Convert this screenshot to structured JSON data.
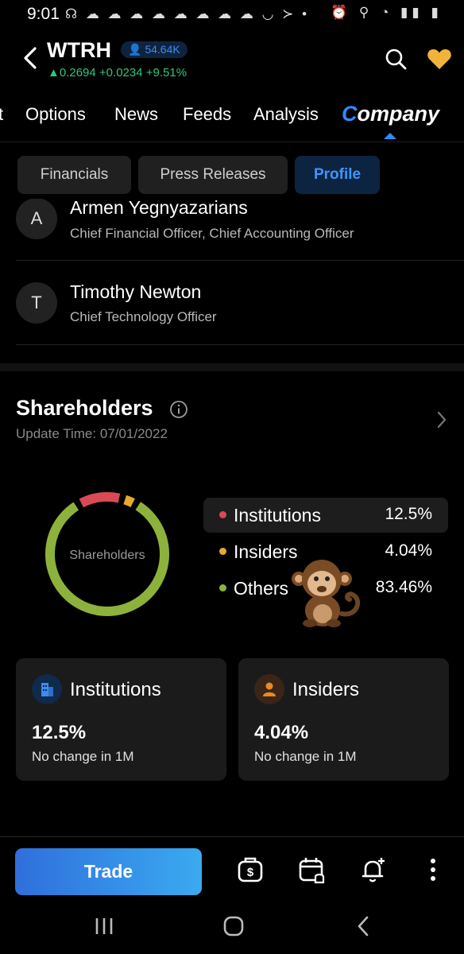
{
  "status_bar": {
    "time": "9:01",
    "left_icons": "☊ ☁ ☁ ☁ ☁ ☁ ☁ ☁ ☁ ◡ ≻ •",
    "right_icons": "⏰ ⚲ ◔ ▮▮ ▮"
  },
  "header": {
    "ticker": "WTRH",
    "followers": "54.64K",
    "price": "0.2694",
    "change": "+0.0234",
    "change_pct": "+9.51%",
    "up_color": "#2dc87a"
  },
  "nav_tabs": {
    "partial": "t",
    "options": "Options",
    "news": "News",
    "feeds": "Feeds",
    "analysis": "Analysis",
    "company_first": "C",
    "company_rest": "ompany"
  },
  "sub_tabs": {
    "financials": "Financials",
    "press_releases": "Press Releases",
    "profile": "Profile"
  },
  "executives": [
    {
      "initial": "A",
      "name": "Armen Yegnyazarians",
      "title": "Chief Financial Officer, Chief Accounting Officer"
    },
    {
      "initial": "T",
      "name": "Timothy Newton",
      "title": "Chief Technology Officer"
    }
  ],
  "shareholders": {
    "title": "Shareholders",
    "update_time": "Update Time: 07/01/2022",
    "donut_label": "Shareholders",
    "legend": [
      {
        "name": "Institutions",
        "value": "12.5%",
        "pct": 12.5,
        "color": "#d94a55"
      },
      {
        "name": "Insiders",
        "value": "4.04%",
        "pct": 4.04,
        "color": "#e9a92c"
      },
      {
        "name": "Others",
        "value": "83.46%",
        "pct": 83.46,
        "color": "#8db23c"
      }
    ]
  },
  "cards": {
    "institutions": {
      "title": "Institutions",
      "value": "12.5%",
      "note": "No change in 1M"
    },
    "insiders": {
      "title": "Insiders",
      "value": "4.04%",
      "note": "No change in 1M"
    }
  },
  "bottom_bar": {
    "trade_label": "Trade"
  },
  "icons": {
    "back": "back-icon",
    "search": "search-icon",
    "heart": "heart-icon",
    "info": "info-icon",
    "chevron": "chevron-right-icon",
    "wallet": "dollar-wallet-icon",
    "calendar": "calendar-alert-icon",
    "bell": "bell-add-icon",
    "more": "more-vertical-icon",
    "monkey": "monkey-emoji"
  }
}
